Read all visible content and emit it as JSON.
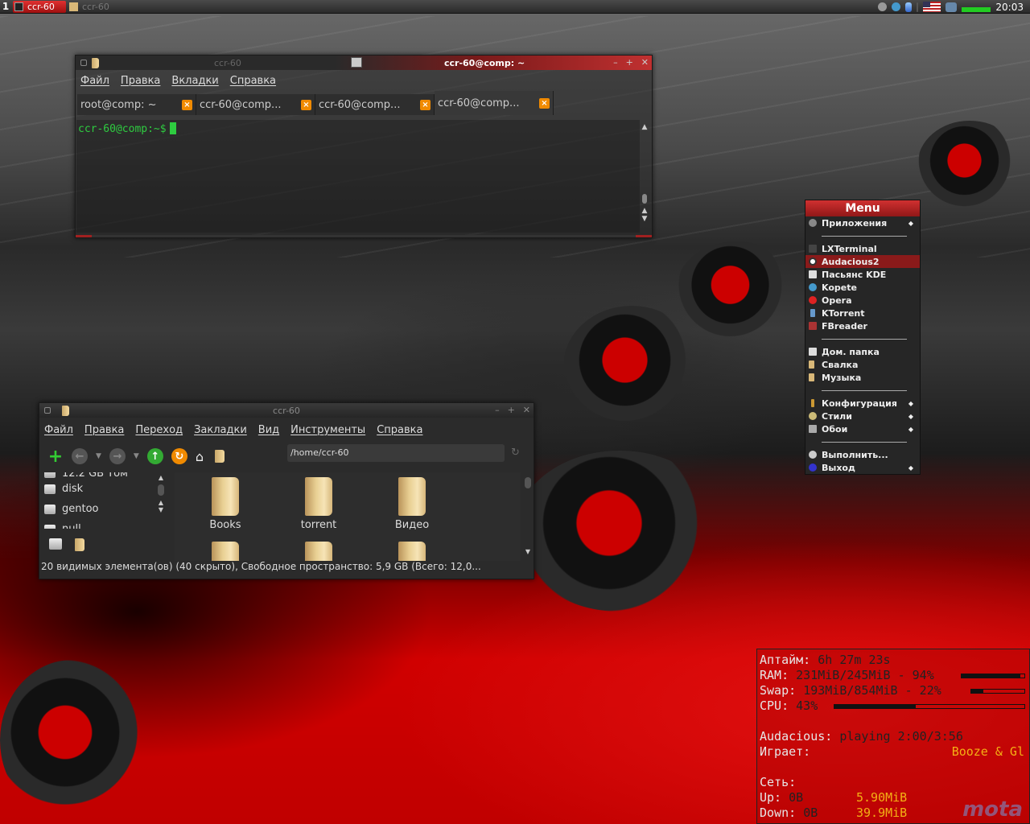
{
  "panel": {
    "desktop_number": "1",
    "tasks": [
      {
        "title": "ccr-60",
        "icon": "terminal-icon",
        "active": true
      },
      {
        "title": "ccr-60",
        "icon": "folder-icon",
        "active": false
      }
    ],
    "clock": "20:03",
    "colors": {
      "active_task": "#c82020",
      "cpu_graph": "#22cc22"
    }
  },
  "terminal": {
    "tab_title": "ccr-60",
    "window_title": "ccr-60@comp: ~",
    "menu": [
      "Файл",
      "Правка",
      "Вкладки",
      "Справка"
    ],
    "tabs": [
      "root@comp: ~",
      "ccr-60@comp...",
      "ccr-60@comp...",
      "ccr-60@comp..."
    ],
    "active_tab": 3,
    "prompt": "ccr-60@comp:~$",
    "prompt_color": "#2ecc40"
  },
  "filemanager": {
    "title": "ccr-60",
    "menu": [
      "Файл",
      "Правка",
      "Переход",
      "Закладки",
      "Вид",
      "Инструменты",
      "Справка"
    ],
    "path": "/home/ccr-60",
    "sidebar": [
      "12.2 GB Том",
      "disk",
      "gentoo",
      "null"
    ],
    "items": [
      "Books",
      "torrent",
      "Видео",
      "",
      "",
      ""
    ],
    "status": "20 видимых элемента(ов) (40 скрыто), Свободное пространство: 5,9 GB (Всего: 12,0..."
  },
  "menu": {
    "title": "Menu",
    "items": [
      {
        "label": "Приложения",
        "icon": "apps-icon",
        "submenu": true
      },
      {
        "label": "LXTerminal",
        "icon": "terminal-icon"
      },
      {
        "label": "Audacious2",
        "icon": "audacious-icon",
        "highlighted": true
      },
      {
        "label": "Пасьянс KDE",
        "icon": "cards-icon"
      },
      {
        "label": "Kopete",
        "icon": "kopete-icon"
      },
      {
        "label": "Opera",
        "icon": "opera-icon"
      },
      {
        "label": "KTorrent",
        "icon": "ktorrent-icon"
      },
      {
        "label": "FBreader",
        "icon": "fbreader-icon"
      },
      {
        "label": "Дом. папка",
        "icon": "home-icon"
      },
      {
        "label": "Свалка",
        "icon": "folder-icon"
      },
      {
        "label": "Музыка",
        "icon": "folder-icon"
      },
      {
        "label": "Конфигурация",
        "icon": "wrench-icon",
        "submenu": true
      },
      {
        "label": "Стили",
        "icon": "palette-icon",
        "submenu": true
      },
      {
        "label": "Обои",
        "icon": "wallpaper-icon",
        "submenu": true
      },
      {
        "label": "Выполнить...",
        "icon": "gear-icon"
      },
      {
        "label": "Выход",
        "icon": "exit-icon",
        "submenu": true
      }
    ]
  },
  "conky": {
    "uptime_label": "Аптайм:",
    "uptime": "6h 27m 23s",
    "ram_label": "RAM:",
    "ram": "231MiB/245MiB - 94%",
    "ram_pct": 94,
    "swap_label": "Swap:",
    "swap": "193MiB/854MiB - 22%",
    "swap_pct": 22,
    "cpu_label": "CPU:",
    "cpu": "43%",
    "cpu_pct": 43,
    "audacious_label": "Audacious:",
    "audacious": "playing 2:00/3:56",
    "playing_label": "Играет:",
    "playing": "Booze & Gl",
    "net_label": "Сеть:",
    "up_label": "Up:",
    "up": "0B",
    "up_total": "5.90MiB",
    "down_label": "Down:",
    "down": "0B",
    "down_total": "39.9MiB",
    "watermark": "mota"
  }
}
